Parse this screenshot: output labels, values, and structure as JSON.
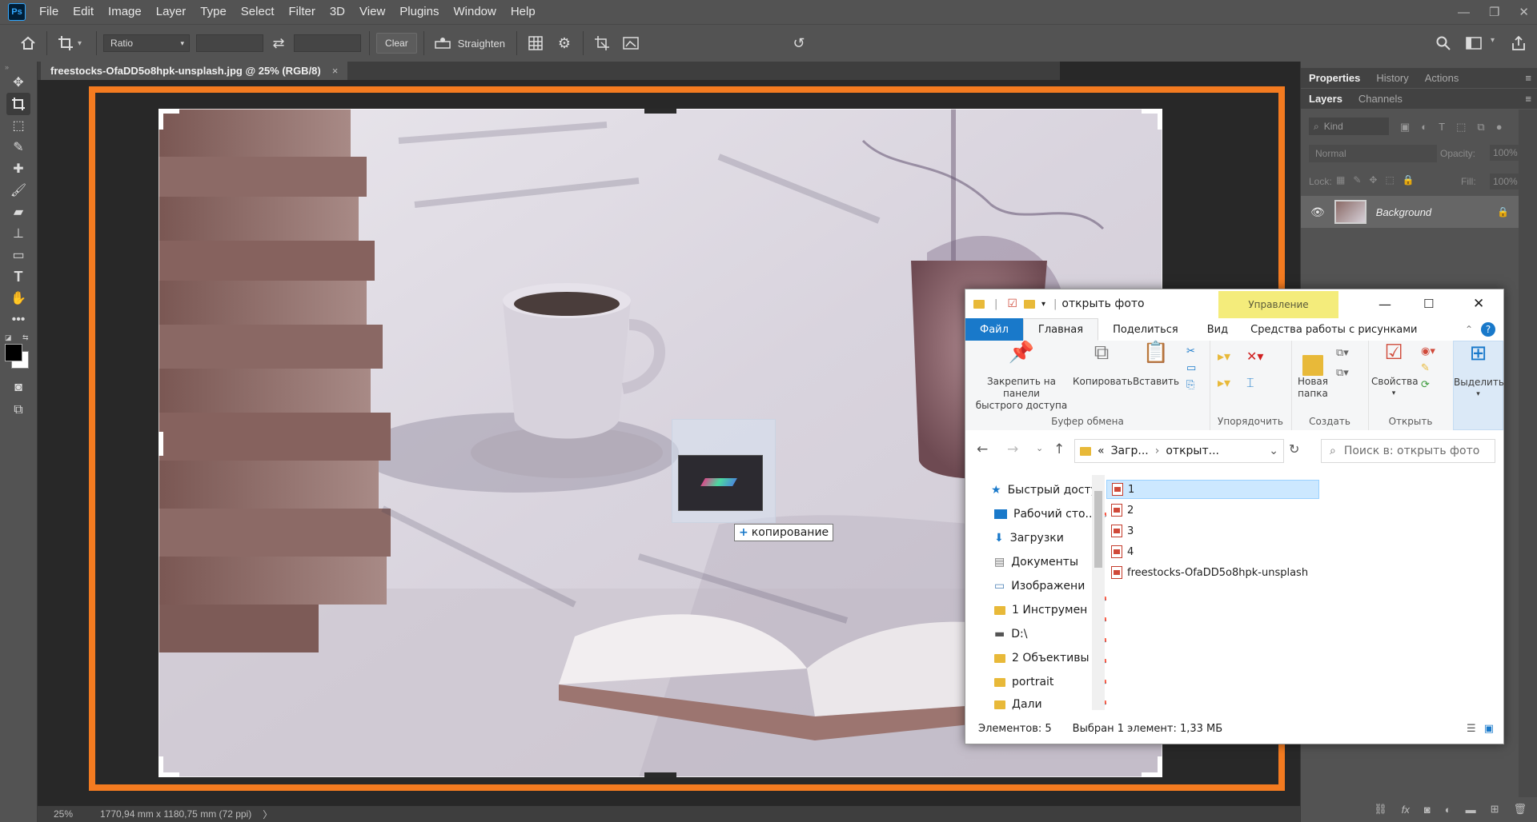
{
  "app": {
    "logo": "Ps",
    "menu": [
      "File",
      "Edit",
      "Image",
      "Layer",
      "Type",
      "Select",
      "Filter",
      "3D",
      "View",
      "Plugins",
      "Window",
      "Help"
    ]
  },
  "options": {
    "ratio_value": "Ratio",
    "clear_label": "Clear",
    "straighten_label": "Straighten"
  },
  "document": {
    "tab_title": "freestocks-OfaDD5o8hpk-unsplash.jpg @ 25% (RGB/8)",
    "close": "×"
  },
  "panels": {
    "top_tabs": [
      "Properties",
      "History",
      "Actions"
    ],
    "layer_tabs": [
      "Layers",
      "Channels"
    ],
    "kind_placeholder": "Kind",
    "blend_mode": "Normal",
    "opacity_label": "Opacity:",
    "opacity_value": "100%",
    "lock_label": "Lock:",
    "fill_label": "Fill:",
    "fill_value": "100%",
    "layer_name": "Background"
  },
  "status": {
    "zoom": "25%",
    "doc_size": "1770,94 mm x 1180,75 mm (72 ppi)",
    "arrow": "〉"
  },
  "drag": {
    "label": "копирование"
  },
  "explorer": {
    "title": "открыть фото",
    "manage_tab": "Управление",
    "tabs": [
      "Файл",
      "Главная",
      "Поделиться",
      "Вид",
      "Средства работы с рисунками"
    ],
    "clipboard": {
      "pin_label_1": "Закрепить на панели",
      "pin_label_2": "быстрого доступа",
      "copy_label": "Копировать",
      "paste_label": "Вставить",
      "group_label": "Буфер обмена"
    },
    "organize_label": "Упорядочить",
    "new": {
      "folder_label_1": "Новая",
      "folder_label_2": "папка",
      "group_label": "Создать"
    },
    "open": {
      "props_label": "Свойства",
      "group_label": "Открыть"
    },
    "select_label": "Выделить",
    "address": {
      "part1": "Загр...",
      "part2": "открыт...",
      "prefix": "«"
    },
    "search_placeholder": "Поиск в: открыть фото",
    "nav": [
      "Быстрый доступ",
      "Рабочий сто...",
      "Загрузки",
      "Документы",
      "Изображени",
      "1 Инструмен",
      "D:\\",
      "2 Объективы",
      "portrait",
      "Дали"
    ],
    "files": [
      "1",
      "2",
      "3",
      "4",
      "freestocks-OfaDD5o8hpk-unsplash"
    ],
    "status_count": "Элементов: 5",
    "status_selected": "Выбран 1 элемент: 1,33 МБ"
  },
  "colors": {
    "crop_border": "#f47b20",
    "ps_blue": "#31a8ff",
    "manage_band": "#f4ec7b",
    "explorer_accent": "#1979ca"
  }
}
